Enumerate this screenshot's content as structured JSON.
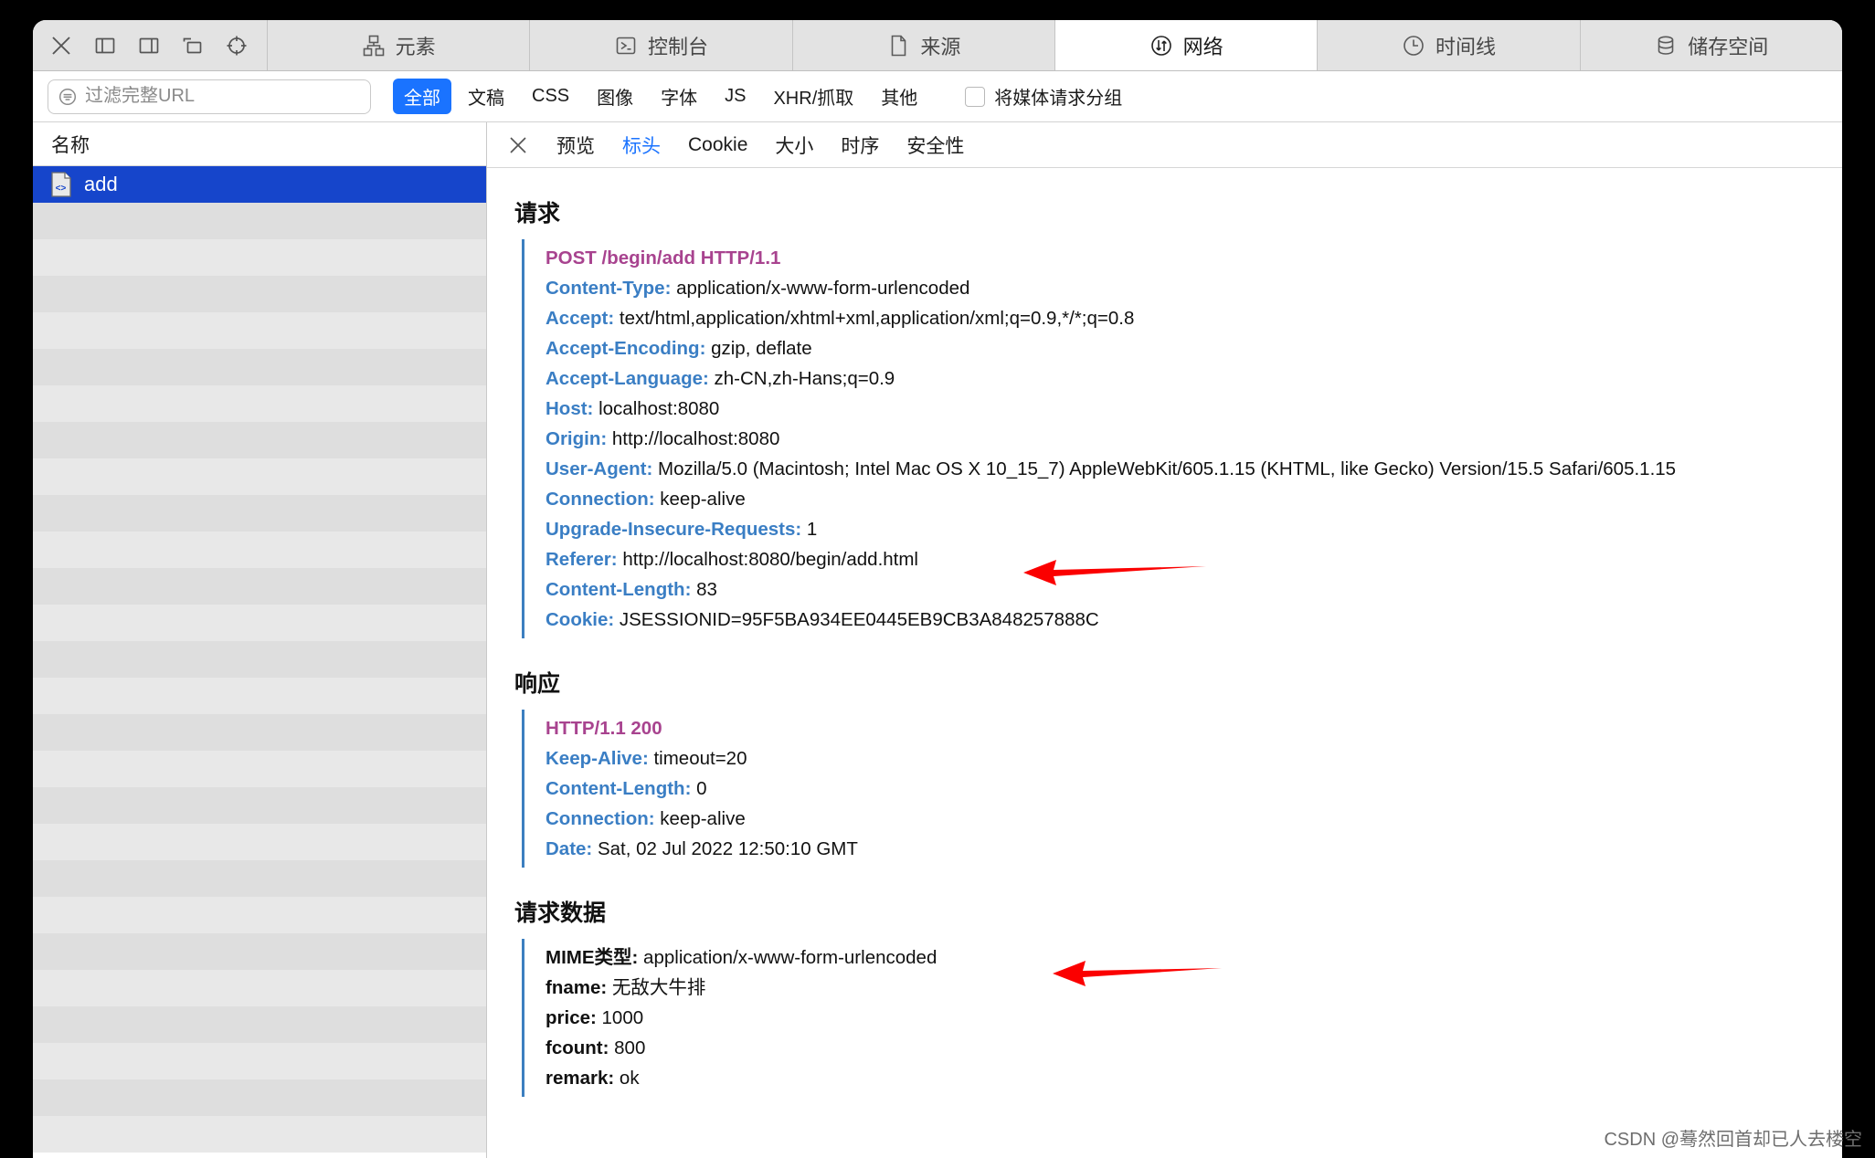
{
  "window": {
    "toolbar_icons": [
      {
        "name": "close-icon",
        "glyph": "x"
      },
      {
        "name": "dock-left-icon",
        "glyph": "dock-left"
      },
      {
        "name": "dock-right-icon",
        "glyph": "dock-right"
      },
      {
        "name": "detach-window-icon",
        "glyph": "detach"
      },
      {
        "name": "inspect-element-icon",
        "glyph": "crosshair"
      }
    ],
    "tabs": [
      {
        "label": "元素",
        "icon": "elements-icon",
        "active": false
      },
      {
        "label": "控制台",
        "icon": "console-icon",
        "active": false
      },
      {
        "label": "来源",
        "icon": "sources-icon",
        "active": false
      },
      {
        "label": "网络",
        "icon": "network-icon",
        "active": true
      },
      {
        "label": "时间线",
        "icon": "timeline-icon",
        "active": false
      },
      {
        "label": "储存空间",
        "icon": "storage-icon",
        "active": false
      }
    ]
  },
  "filterbar": {
    "search": {
      "placeholder": "过滤完整URL",
      "value": "",
      "icon": "filter-icon"
    },
    "chips": [
      {
        "label": "全部",
        "active": true
      },
      {
        "label": "文稿",
        "active": false
      },
      {
        "label": "CSS",
        "active": false
      },
      {
        "label": "图像",
        "active": false
      },
      {
        "label": "字体",
        "active": false
      },
      {
        "label": "JS",
        "active": false
      },
      {
        "label": "XHR/抓取",
        "active": false
      },
      {
        "label": "其他",
        "active": false
      }
    ],
    "group_media": {
      "label": "将媒体请求分组",
      "checked": false
    }
  },
  "sidebar": {
    "column_header": "名称",
    "items": [
      {
        "label": "add",
        "icon": "code-document-icon",
        "selected": true
      }
    ],
    "empty_row_count": 26
  },
  "detail": {
    "close_label": "×",
    "tabs": [
      {
        "label": "预览",
        "active": false
      },
      {
        "label": "标头",
        "active": true
      },
      {
        "label": "Cookie",
        "active": false
      },
      {
        "label": "大小",
        "active": false
      },
      {
        "label": "时序",
        "active": false
      },
      {
        "label": "安全性",
        "active": false
      }
    ],
    "sections": [
      {
        "title": "请求",
        "lines": [
          {
            "type": "status",
            "text": "POST /begin/add HTTP/1.1"
          },
          {
            "type": "kv",
            "key": "Content-Type:",
            "value": "application/x-www-form-urlencoded"
          },
          {
            "type": "kv",
            "key": "Accept:",
            "value": "text/html,application/xhtml+xml,application/xml;q=0.9,*/*;q=0.8"
          },
          {
            "type": "kv",
            "key": "Accept-Encoding:",
            "value": "gzip, deflate"
          },
          {
            "type": "kv",
            "key": "Accept-Language:",
            "value": "zh-CN,zh-Hans;q=0.9"
          },
          {
            "type": "kv",
            "key": "Host:",
            "value": "localhost:8080"
          },
          {
            "type": "kv",
            "key": "Origin:",
            "value": "http://localhost:8080"
          },
          {
            "type": "kv",
            "key": "User-Agent:",
            "value": "Mozilla/5.0 (Macintosh; Intel Mac OS X 10_15_7) AppleWebKit/605.1.15 (KHTML, like Gecko) Version/15.5 Safari/605.1.15"
          },
          {
            "type": "kv",
            "key": "Connection:",
            "value": "keep-alive"
          },
          {
            "type": "kv",
            "key": "Upgrade-Insecure-Requests:",
            "value": "1"
          },
          {
            "type": "kv",
            "key": "Referer:",
            "value": "http://localhost:8080/begin/add.html"
          },
          {
            "type": "kv",
            "key": "Content-Length:",
            "value": "83"
          },
          {
            "type": "kv",
            "key": "Cookie:",
            "value": "JSESSIONID=95F5BA934EE0445EB9CB3A848257888C"
          }
        ]
      },
      {
        "title": "响应",
        "lines": [
          {
            "type": "status",
            "text": "HTTP/1.1 200"
          },
          {
            "type": "kv",
            "key": "Keep-Alive:",
            "value": "timeout=20"
          },
          {
            "type": "kv",
            "key": "Content-Length:",
            "value": "0"
          },
          {
            "type": "kv",
            "key": "Connection:",
            "value": "keep-alive"
          },
          {
            "type": "kv",
            "key": "Date:",
            "value": "Sat, 02 Jul 2022 12:50:10 GMT"
          }
        ]
      },
      {
        "title": "请求数据",
        "lines": [
          {
            "type": "kv-dark",
            "key": "MIME类型:",
            "value": "application/x-www-form-urlencoded"
          },
          {
            "type": "kv-dark",
            "key": "fname:",
            "value": "无敌大牛排"
          },
          {
            "type": "kv-dark",
            "key": "price:",
            "value": "1000"
          },
          {
            "type": "kv-dark",
            "key": "fcount:",
            "value": "800"
          },
          {
            "type": "kv-dark",
            "key": "remark:",
            "value": "ok"
          }
        ]
      }
    ]
  },
  "annotations": {
    "arrow_color": "#fb0000",
    "arrows": [
      {
        "name": "referer-arrow",
        "target": "Referer:"
      },
      {
        "name": "request-data-arrow",
        "target": "MIME类型:"
      }
    ]
  },
  "watermark": {
    "text": "CSDN @蓦然回首却已人去楼空"
  },
  "colors": {
    "accent_blue": "#1a73ff",
    "selection_blue": "#1645cb",
    "header_key_blue": "#3a7ec4",
    "status_purple": "#a8438f",
    "arrow_red": "#fb0000"
  }
}
